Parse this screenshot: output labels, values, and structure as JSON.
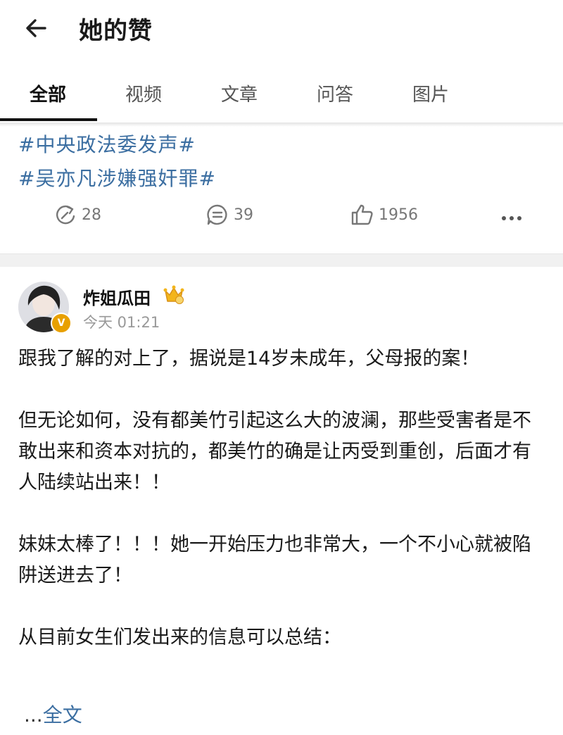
{
  "header": {
    "title": "她的赞",
    "back_icon": "arrow-left-icon"
  },
  "tabs": [
    {
      "label": "全部",
      "active": true
    },
    {
      "label": "视频",
      "active": false
    },
    {
      "label": "文章",
      "active": false
    },
    {
      "label": "问答",
      "active": false
    },
    {
      "label": "图片",
      "active": false
    }
  ],
  "prev_post": {
    "topics": [
      "#中央政法委发声#",
      "#吴亦凡涉嫌强奸罪#"
    ],
    "actions": {
      "repost": "28",
      "comment": "39",
      "like": "1956"
    }
  },
  "post": {
    "username": "炸姐瓜田",
    "time": "今天 01:21",
    "verified_badge": "V",
    "paragraphs": [
      "跟我了解的对上了，据说是14岁未成年，父母报的案！",
      "但无论如何，没有都美竹引起这么大的波澜，那些受害者是不敢出来和资本对抗的，都美竹的确是让丙受到重创，后面才有人陆续站出来！！",
      "妹妹太棒了！！！她一开始压力也非常大，一个不小心就被陷阱送进去了！",
      "从目前女生们发出来的信息可以总结："
    ],
    "ellipsis": "...",
    "read_more": "全文"
  },
  "colors": {
    "link": "#3b6ea1",
    "meta": "#999999",
    "badge": "#e8a000"
  }
}
